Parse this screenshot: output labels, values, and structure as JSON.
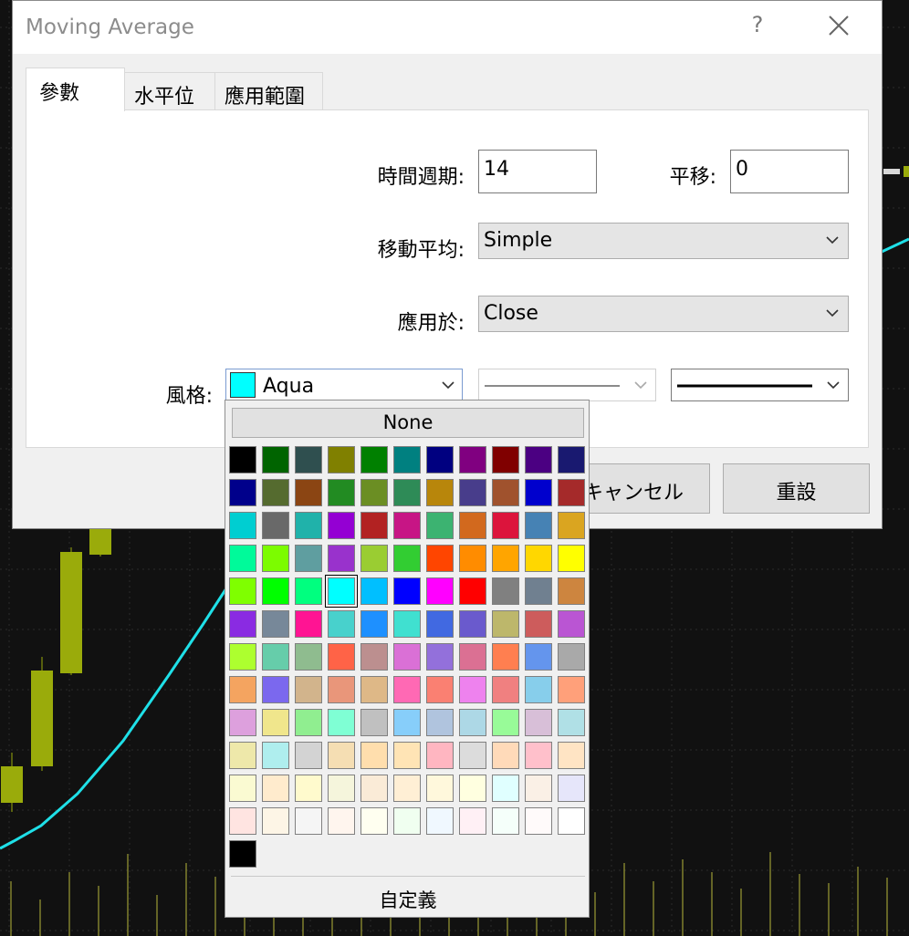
{
  "dialog": {
    "title": "Moving Average",
    "help_glyph": "?",
    "tabs": [
      "參數",
      "水平位",
      "應用範圍"
    ],
    "fields": {
      "period_label": "時間週期:",
      "period_value": "14",
      "shift_label": "平移:",
      "shift_value": "0",
      "ma_method_label": "移動平均:",
      "ma_method_value": "Simple",
      "apply_to_label": "應用於:",
      "apply_to_value": "Close",
      "style_label": "風格:",
      "color_value": "Aqua",
      "color_hex": "#00ffff"
    },
    "buttons": {
      "cancel": "キャンセル",
      "reset": "重設"
    }
  },
  "color_picker": {
    "none_label": "None",
    "custom_label": "自定義",
    "selected": "#00ffff",
    "rows": [
      [
        "#000000",
        "#006400",
        "#2f4f4f",
        "#808000",
        "#008000",
        "#008080",
        "#000080",
        "#800080",
        "#800000",
        "#4b0082",
        "#191970"
      ],
      [
        "#00008b",
        "#556b2f",
        "#8b4513",
        "#228b22",
        "#6b8e23",
        "#2e8b57",
        "#b8860b",
        "#483d8b",
        "#a0522d",
        "#0000cd",
        "#a52a2a"
      ],
      [
        "#00ced1",
        "#696969",
        "#20b2aa",
        "#9400d3",
        "#b22222",
        "#c71585",
        "#3cb371",
        "#d2691e",
        "#dc143c",
        "#4682b4",
        "#daa520"
      ],
      [
        "#00fa9a",
        "#7cfc00",
        "#5f9ea0",
        "#9932cc",
        "#9acd32",
        "#32cd32",
        "#ff4500",
        "#ff8c00",
        "#ffa500",
        "#ffd700",
        "#ffff00"
      ],
      [
        "#7fff00",
        "#00ff00",
        "#00ff7f",
        "#00ffff",
        "#00bfff",
        "#0000ff",
        "#ff00ff",
        "#ff0000",
        "#808080",
        "#708090",
        "#cd853f"
      ],
      [
        "#8a2be2",
        "#778899",
        "#ff1493",
        "#48d1cc",
        "#1e90ff",
        "#40e0d0",
        "#4169e1",
        "#6a5acd",
        "#bdb76b",
        "#cd5c5c",
        "#ba55d3"
      ],
      [
        "#adff2f",
        "#66cdaa",
        "#8fbc8f",
        "#ff6347",
        "#bc8f8f",
        "#da70d6",
        "#9370db",
        "#db7093",
        "#ff7f50",
        "#6495ed",
        "#a9a9a9"
      ],
      [
        "#f4a460",
        "#7b68ee",
        "#d2b48c",
        "#e9967a",
        "#deb887",
        "#ff69b4",
        "#fa8072",
        "#ee82ee",
        "#f08080",
        "#87ceeb",
        "#ffa07a"
      ],
      [
        "#dda0dd",
        "#f0e68c",
        "#90ee90",
        "#7fffd4",
        "#c0c0c0",
        "#87cefa",
        "#b0c4de",
        "#add8e6",
        "#98fb98",
        "#d8bfd8",
        "#b0e0e6"
      ],
      [
        "#eee8aa",
        "#afeeee",
        "#d3d3d3",
        "#f5deb3",
        "#ffdead",
        "#ffe4b5",
        "#ffb6c1",
        "#dcdcdc",
        "#ffdab9",
        "#ffc0cb",
        "#ffe4c4"
      ],
      [
        "#fafad2",
        "#ffebcd",
        "#fffacd",
        "#f5f5dc",
        "#faebd7",
        "#ffefd5",
        "#fff8dc",
        "#ffffe0",
        "#e0ffff",
        "#faf0e6",
        "#e6e6fa"
      ],
      [
        "#ffe4e1",
        "#fdf5e6",
        "#f5f5f5",
        "#fff5ee",
        "#fffff0",
        "#f0fff0",
        "#f0f8ff",
        "#fff0f5",
        "#f5fffa",
        "#fffafa",
        "#ffffff"
      ],
      [
        "#000000"
      ]
    ]
  },
  "chart": {
    "background": "#111111",
    "candle_color": "#9aab0b",
    "ma_line_color": "#1fe0e8",
    "volume_color": "#b7b73a"
  }
}
